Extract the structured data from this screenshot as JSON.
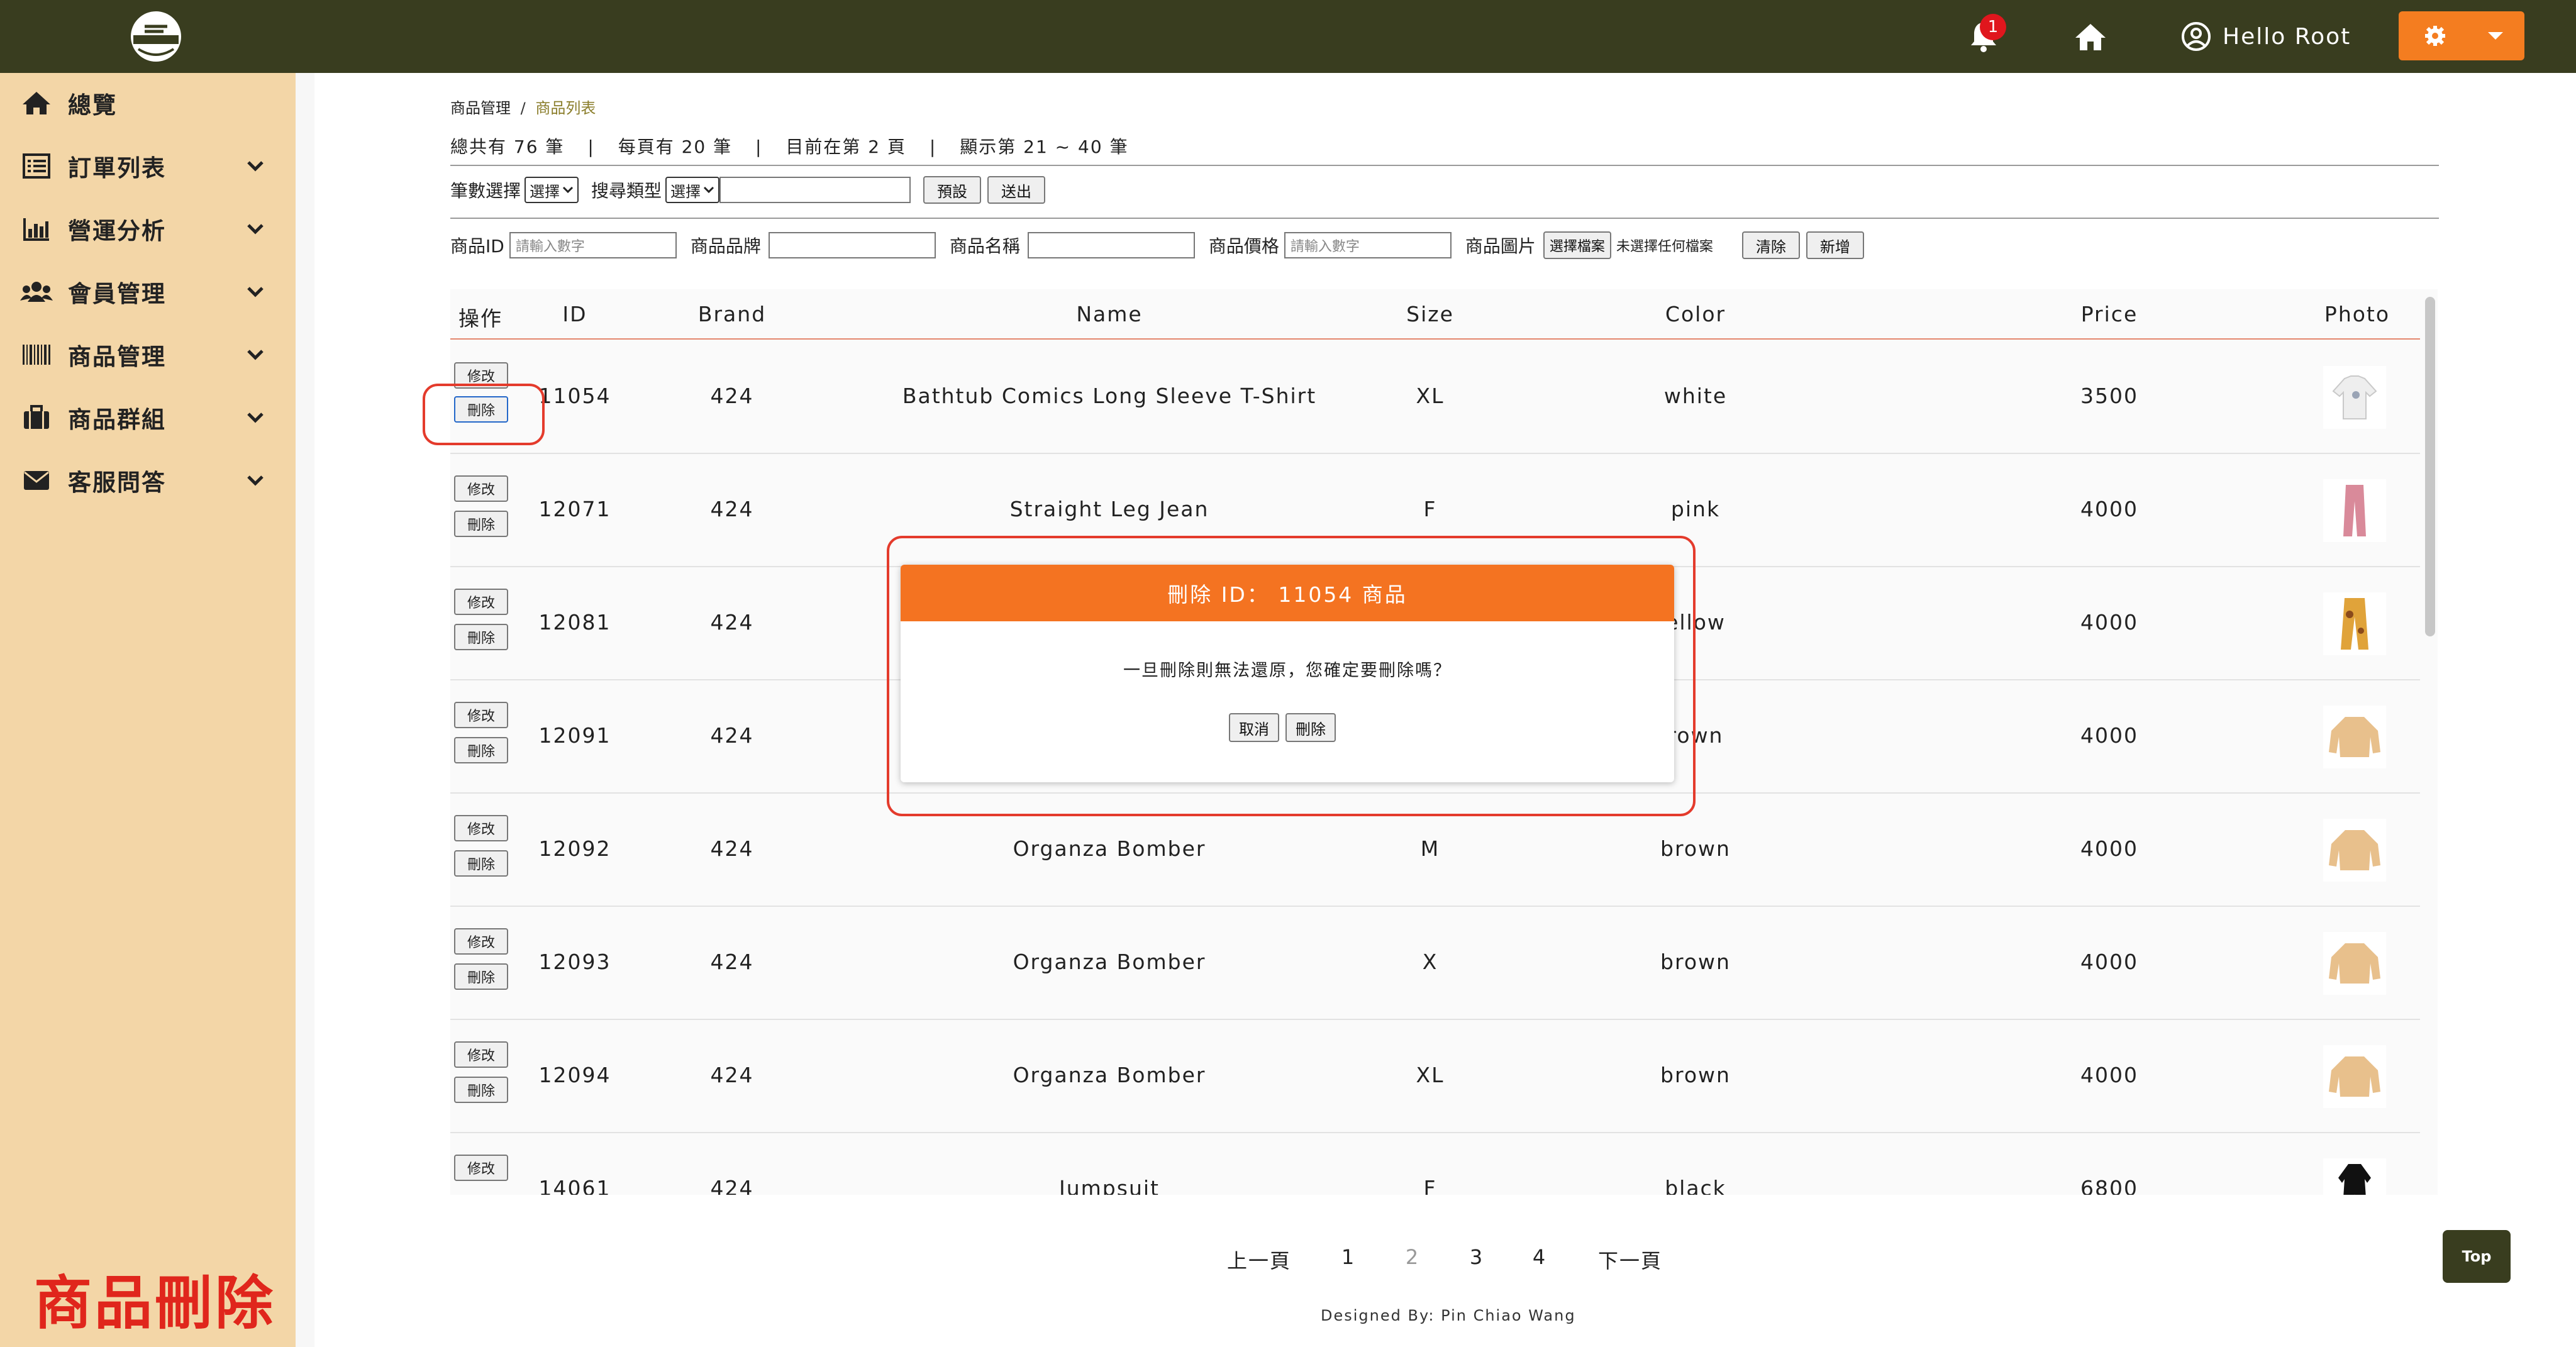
{
  "header": {
    "notification_count": "1",
    "greeting": "Hello Root"
  },
  "sidebar": {
    "items": [
      {
        "label": "總覽",
        "icon": "home-icon"
      },
      {
        "label": "訂單列表",
        "icon": "list-icon"
      },
      {
        "label": "營運分析",
        "icon": "bar-chart-icon"
      },
      {
        "label": "會員管理",
        "icon": "users-icon"
      },
      {
        "label": "商品管理",
        "icon": "barcode-icon"
      },
      {
        "label": "商品群組",
        "icon": "briefcase-icon"
      },
      {
        "label": "客服問答",
        "icon": "envelope-icon"
      }
    ],
    "page_label": "商品刪除"
  },
  "breadcrumb": {
    "parent": "商品管理",
    "separator": "/",
    "current": "商品列表"
  },
  "stats": {
    "total": "總共有 76 筆",
    "per_page": "每頁有 20 筆",
    "current_page": "目前在第 2 頁",
    "showing": "顯示第 21 ~ 40 筆",
    "divider": "|"
  },
  "filters": {
    "count_label": "筆數選擇",
    "count_select": "選擇",
    "search_type_label": "搜尋類型",
    "search_type_select": "選擇",
    "search_value": "",
    "default_button": "預設",
    "submit_button": "送出"
  },
  "add_form": {
    "id_label": "商品ID",
    "id_placeholder": "請輸入數字",
    "brand_label": "商品品牌",
    "name_label": "商品名稱",
    "price_label": "商品價格",
    "price_placeholder": "請輸入數字",
    "image_label": "商品圖片",
    "choose_file_button": "選擇檔案",
    "no_file_text": "未選擇任何檔案",
    "clear_button": "清除",
    "add_button": "新增"
  },
  "table": {
    "headers": {
      "op": "操作",
      "id": "ID",
      "brand": "Brand",
      "name": "Name",
      "size": "Size",
      "color": "Color",
      "price": "Price",
      "photo": "Photo"
    },
    "edit_label": "修改",
    "delete_label": "刪除",
    "rows": [
      {
        "id": "11054",
        "brand": "424",
        "name": "Bathtub Comics Long Sleeve T-Shirt",
        "size": "XL",
        "color": "white",
        "price": "3500",
        "photo": "shirt-thumbnail"
      },
      {
        "id": "12071",
        "brand": "424",
        "name": "Straight Leg Jean",
        "size": "F",
        "color": "pink",
        "price": "4000",
        "photo": "jeans-thumbnail"
      },
      {
        "id": "12081",
        "brand": "424",
        "name": "",
        "size": "",
        "color": "ellow",
        "price": "4000",
        "photo": "pants-thumbnail"
      },
      {
        "id": "12091",
        "brand": "424",
        "name": "",
        "size": "",
        "color": "rown",
        "price": "4000",
        "photo": "jacket-thumbnail"
      },
      {
        "id": "12092",
        "brand": "424",
        "name": "Organza Bomber",
        "size": "M",
        "color": "brown",
        "price": "4000",
        "photo": "jacket-thumbnail"
      },
      {
        "id": "12093",
        "brand": "424",
        "name": "Organza Bomber",
        "size": "X",
        "color": "brown",
        "price": "4000",
        "photo": "jacket-thumbnail"
      },
      {
        "id": "12094",
        "brand": "424",
        "name": "Organza Bomber",
        "size": "XL",
        "color": "brown",
        "price": "4000",
        "photo": "jacket-thumbnail"
      },
      {
        "id": "14061",
        "brand": "424",
        "name": "Jumpsuit",
        "size": "F",
        "color": "black",
        "price": "6800",
        "photo": "jumpsuit-thumbnail"
      }
    ]
  },
  "modal": {
    "title": "刪除 ID： 11054 商品",
    "message": "一旦刪除則無法還原，您確定要刪除嗎？",
    "cancel_button": "取消",
    "confirm_button": "刪除"
  },
  "pagination": {
    "prev": "上一頁",
    "pages": [
      "1",
      "2",
      "3",
      "4"
    ],
    "active_page": "2",
    "next": "下一頁"
  },
  "footer": {
    "credit": "Designed By: Pin Chiao Wang"
  },
  "top_button": "Top",
  "colors": {
    "topbar": "#393d1f",
    "sidebar": "#f3d6a7",
    "accent": "#f47321",
    "highlight": "#e43b2c"
  }
}
